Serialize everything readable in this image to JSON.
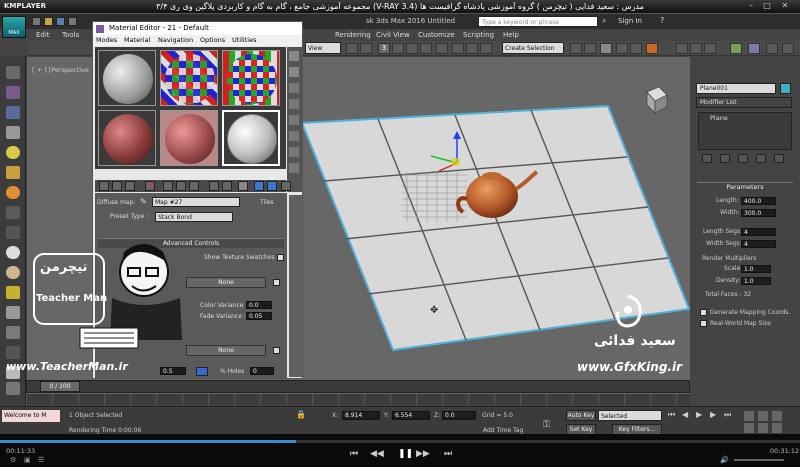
{
  "player": {
    "logo": "KMPLAYER",
    "title": "مجموعه آموزشی جامع ، گام به گام و کاربردی پلاگین وی ری ۳/۴ (V-RAY 3.4) مدرس : سعید فدایی ( تیچرمن ) گروه آموزشی پادشاه گرافیست ها",
    "time_current": "00:11:33",
    "time_total": "00:31:12"
  },
  "app": {
    "max_label": "MAX",
    "title": "sk 3ds Max 2016    Untitled",
    "search_placeholder": "Type a keyword or phrase",
    "sign_in": "Sign In",
    "menus": [
      "Edit",
      "Tools",
      "Rendering",
      "Civil View",
      "Customize",
      "Scripting",
      "Help"
    ],
    "view_dropdown": "View",
    "selection_set": "Create Selection Se",
    "snap_label": "3"
  },
  "viewport": {
    "label": "[ + ] [Perspective ] [ Realistic ]"
  },
  "command_panel": {
    "object_name": "Plane001",
    "modifier_list": "Modifier List",
    "stack_item": "Plane",
    "parameters_title": "Parameters",
    "params": [
      {
        "label": "Length:",
        "value": "400.0"
      },
      {
        "label": "Width:",
        "value": "300.0"
      },
      {
        "label": "Length Segs:",
        "value": "4"
      },
      {
        "label": "Width Segs:",
        "value": "4"
      }
    ],
    "render_mult_title": "Render Multipliers",
    "render_params": [
      {
        "label": "Scale:",
        "value": "1.0"
      },
      {
        "label": "Density:",
        "value": "1.0"
      }
    ],
    "total_faces": "Total Faces : 32",
    "gen_mapping": "Generate Mapping Coords.",
    "real_world": "Real-World Map Size"
  },
  "material_editor": {
    "title": "Material Editor - 21 - Default",
    "menus": [
      "Modes",
      "Material",
      "Navigation",
      "Options",
      "Utilities"
    ],
    "diffuse_label": "Diffuse map:",
    "map_name": "Map #27",
    "map_type": "Tiles",
    "preset_label": "Preset Type :",
    "preset_value": "Stack Bond",
    "advanced_controls": "Advanced Controls",
    "show_swatches": "Show Texture Swatches",
    "none1": "None",
    "color_variance_label": "Color Variance :",
    "color_variance": "0.0",
    "fade_variance_label": "Fade Variance :",
    "fade_variance": "0.05",
    "none2": "None",
    "holes_label": "% Holes",
    "holes_value": "0",
    "r_value": "0.5"
  },
  "watermarks": {
    "teacherman_site": "www.TeacherMan.ir",
    "gfxking_site": "www.GfxKing.ir",
    "persian_name": "سعید فدائی",
    "logo_fa": "تیچرمن",
    "logo_en": "Teacher Man"
  },
  "status": {
    "frame": "0 / 100",
    "objects": "1 Object Selected",
    "rendering_time": "Rendering Time  0:00:06",
    "x_label": "X:",
    "x": "8.914",
    "y_label": "Y:",
    "y": "6.554",
    "z_label": "Z:",
    "z": "0.0",
    "grid": "Grid = 5.0",
    "add_time_tag": "Add Time Tag",
    "auto_key": "Auto Key",
    "selected": "Selected",
    "set_key": "Set Key",
    "key_filters": "Key Filters...",
    "welcome": "Welcome to M"
  }
}
